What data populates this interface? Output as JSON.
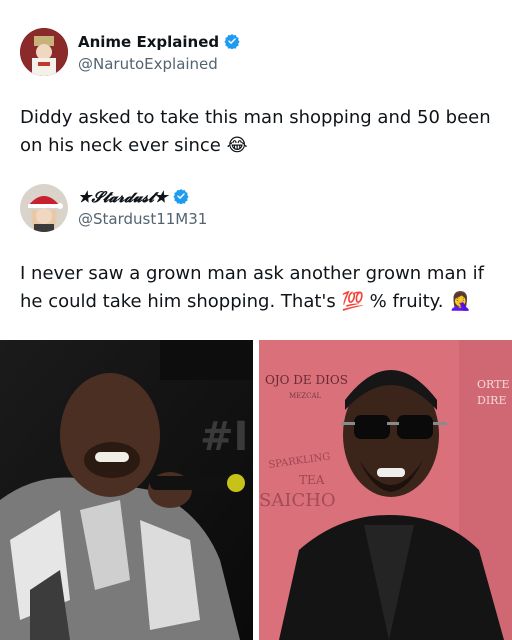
{
  "tweet1": {
    "display_name": "Anime Explained",
    "handle": "@NarutoExplained",
    "text": "Diddy asked to take this man shopping and 50 been on his neck ever since",
    "emoji": "😂",
    "verified_color": "#1d9bf0"
  },
  "tweet2": {
    "display_name": "★𝓢𝓽𝓪𝓻𝓭𝓾𝓼𝓽★",
    "handle": "@Stardust11M31",
    "text_before": "I never saw a grown man ask another grown man if he could take him shopping. That's",
    "emoji_hundred": "💯",
    "text_after": "% fruity.",
    "emoji_end": "🤦‍♀️",
    "verified_color": "#1d9bf0"
  },
  "photos": {
    "right_sign_line1": "OJO DE DIOS",
    "right_sign_line2": "MEZCAL",
    "right_sign_line3": "SPARKLING",
    "right_sign_line4": "TEA",
    "right_sign_line5": "SAICHO",
    "right_sign_edge1": "ORTE",
    "right_sign_edge2": "DIRE",
    "left_backdrop_text": "#I"
  }
}
